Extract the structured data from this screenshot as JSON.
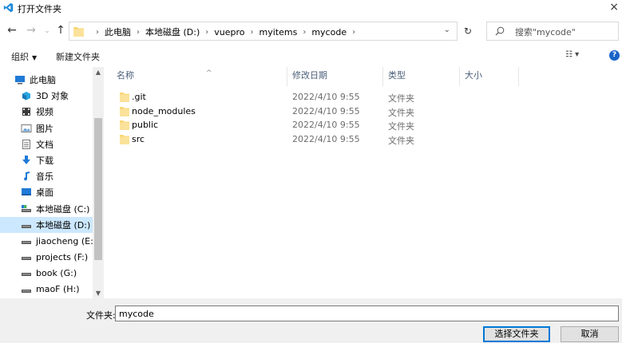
{
  "window": {
    "title": "打开文件夹",
    "icon": "vscode-icon",
    "close_glyph": "×"
  },
  "address": {
    "crumbs": [
      "此电脑",
      "本地磁盘 (D:)",
      "vuepro",
      "myitems",
      "mycode"
    ],
    "search_placeholder": "搜索\"mycode\""
  },
  "toolbar": {
    "organize_label": "组织",
    "new_folder_label": "新建文件夹"
  },
  "nav": {
    "items": [
      {
        "label": "此电脑",
        "icon": "computer-icon",
        "color": "#1f7ad6"
      },
      {
        "label": "3D 对象",
        "icon": "3d-objects-icon",
        "color": "#2aa7e0"
      },
      {
        "label": "视频",
        "icon": "video-icon",
        "color": "#3a3a3a"
      },
      {
        "label": "图片",
        "icon": "pictures-icon",
        "color": "#6aa3d8"
      },
      {
        "label": "文档",
        "icon": "documents-icon",
        "color": "#5a6b7c"
      },
      {
        "label": "下载",
        "icon": "download-icon",
        "color": "#1f7ad6"
      },
      {
        "label": "音乐",
        "icon": "music-icon",
        "color": "#1f7ad6"
      },
      {
        "label": "桌面",
        "icon": "desktop-icon",
        "color": "#1f7ad6"
      },
      {
        "label": "本地磁盘 (C:)",
        "icon": "drive-c-icon",
        "color": "#555555"
      },
      {
        "label": "本地磁盘 (D:)",
        "icon": "drive-d-icon",
        "color": "#555555",
        "selected": true
      },
      {
        "label": "jiaocheng (E:)",
        "icon": "drive-e-icon",
        "color": "#555555"
      },
      {
        "label": "projects (F:)",
        "icon": "drive-f-icon",
        "color": "#555555"
      },
      {
        "label": "book (G:)",
        "icon": "drive-g-icon",
        "color": "#555555"
      },
      {
        "label": "maoF (H:)",
        "icon": "drive-h-icon",
        "color": "#555555"
      }
    ]
  },
  "columns": {
    "name": "名称",
    "date": "修改日期",
    "type": "类型",
    "size": "大小"
  },
  "files": [
    {
      "name": ".git",
      "date": "2022/4/10 9:55",
      "type": "文件夹"
    },
    {
      "name": "node_modules",
      "date": "2022/4/10 9:55",
      "type": "文件夹"
    },
    {
      "name": "public",
      "date": "2022/4/10 9:55",
      "type": "文件夹"
    },
    {
      "name": "src",
      "date": "2022/4/10 9:55",
      "type": "文件夹"
    }
  ],
  "bottom": {
    "folder_label": "文件夹:",
    "folder_value": "mycode",
    "select_button": "选择文件夹",
    "cancel_button": "取消"
  },
  "colors": {
    "folder": "#f8d775",
    "accent": "#0078d7",
    "selection": "#cce8ff"
  }
}
